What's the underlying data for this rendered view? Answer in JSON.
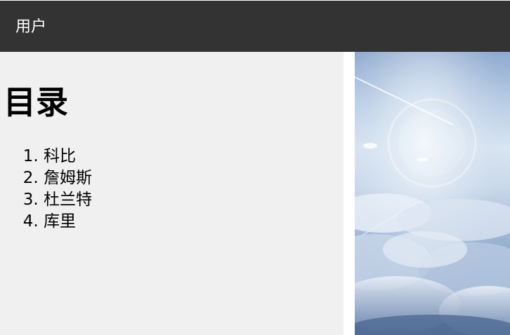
{
  "header": {
    "title": "用户"
  },
  "content": {
    "heading": "目录",
    "list_items": [
      "科比",
      "詹姆斯",
      "杜兰特",
      "库里"
    ]
  },
  "image": {
    "icon": "sky-clouds-image"
  },
  "colors": {
    "header_bg": "#333333",
    "header_text": "#ffffff",
    "panel_bg": "#f0f0f0",
    "text": "#000000"
  }
}
